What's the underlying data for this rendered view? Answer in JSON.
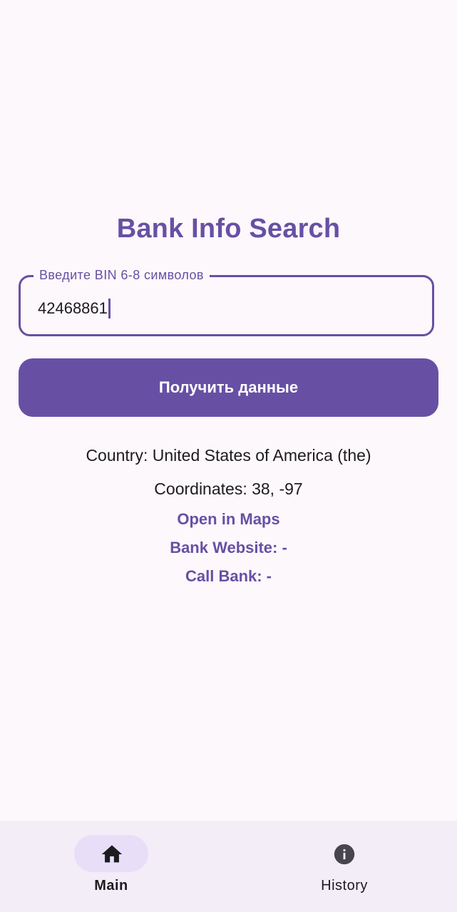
{
  "app": {
    "title": "Bank Info Search"
  },
  "bin_field": {
    "label": "Введите BIN 6-8 символов",
    "value": "42468861"
  },
  "actions": {
    "fetch_label": "Получить данные"
  },
  "result": {
    "country": "Country: United States of America (the)",
    "coordinates": "Coordinates: 38, -97",
    "open_maps": "Open in Maps",
    "bank_website": "Bank Website: -",
    "call_bank": "Call Bank: -"
  },
  "bottom_nav": {
    "items": [
      {
        "label": "Main",
        "icon": "home-icon",
        "selected": true
      },
      {
        "label": "History",
        "icon": "info-icon",
        "selected": false
      }
    ]
  },
  "colors": {
    "primary": "#6750a4",
    "background": "#fdf8fc",
    "nav_background": "#f3edf7",
    "nav_indicator": "#e8def8",
    "on_surface": "#1c1b1f"
  }
}
